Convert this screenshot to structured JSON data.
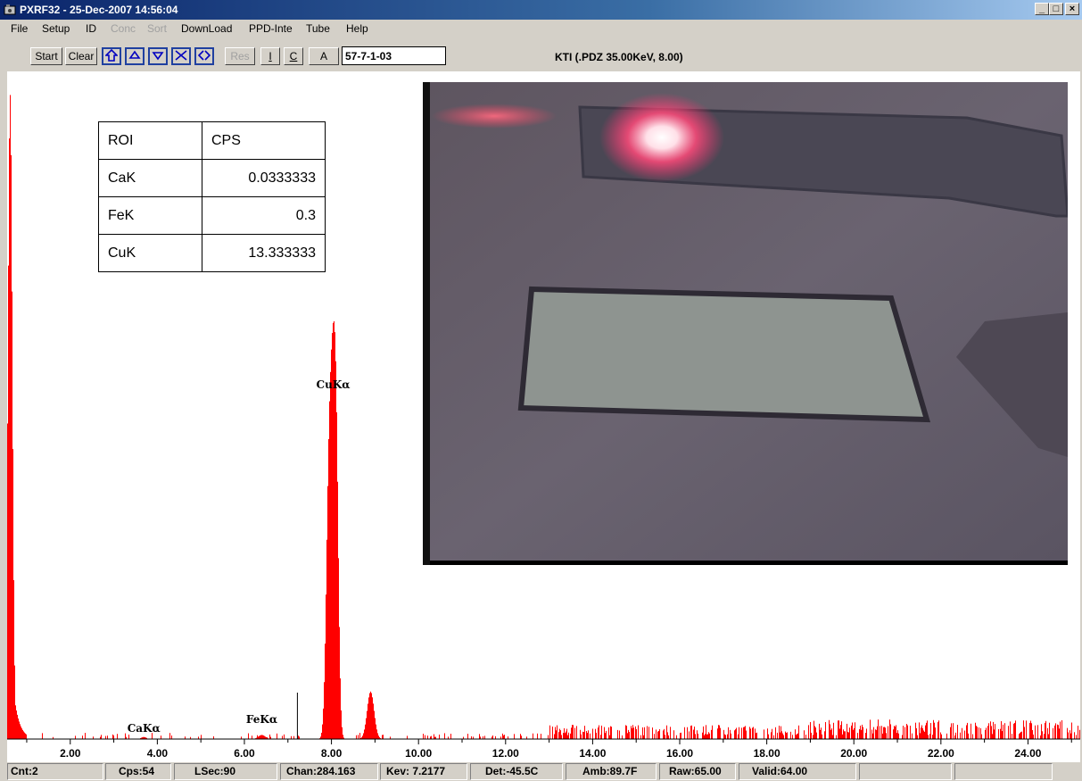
{
  "window": {
    "title": "PXRF32 - 25-Dec-2007 14:56:04",
    "minimize": "_",
    "maximize": "□",
    "close": "×"
  },
  "menu": [
    {
      "label": "File",
      "enabled": true
    },
    {
      "label": "Setup",
      "enabled": true
    },
    {
      "label": "ID",
      "enabled": true
    },
    {
      "label": "Conc",
      "enabled": false
    },
    {
      "label": "Sort",
      "enabled": false
    },
    {
      "label": "DownLoad",
      "enabled": true
    },
    {
      "label": "PPD-Inte",
      "enabled": true
    },
    {
      "label": "Tube",
      "enabled": true
    },
    {
      "label": "Help",
      "enabled": true
    }
  ],
  "toolbar": {
    "start": "Start",
    "clear": "Clear",
    "icon_buttons": [
      "home-up-icon",
      "chevron-up-icon",
      "chevron-down-icon",
      "shrink-icon",
      "expand-icon"
    ],
    "res": "Res",
    "i": "I",
    "c": "C",
    "a": "A",
    "sample_id": "57-7-1-03",
    "tube_info": "KTI  (.PDZ 35.00KeV, 8.00)"
  },
  "roi_table": {
    "headers": [
      "ROI",
      "CPS"
    ],
    "rows": [
      [
        "CaK",
        "0.0333333"
      ],
      [
        "FeK",
        "0.3"
      ],
      [
        "CuK",
        "13.333333"
      ]
    ]
  },
  "chart_data": {
    "type": "bar",
    "x_unit": "keV",
    "xlim": [
      0.55,
      25.2
    ],
    "ticks": [
      "2.00",
      "4.00",
      "6.00",
      "8.00",
      "10.00",
      "12.00",
      "14.00",
      "16.00",
      "18.00",
      "20.00",
      "22.00",
      "24.00"
    ],
    "bar_color": "#ff0000",
    "marker_kev": 7.2177,
    "peak_labels": [
      {
        "label": "CaKα",
        "kev": 3.69
      },
      {
        "label": "FeKα",
        "kev": 6.4
      },
      {
        "label": "CuKα",
        "kev": 8.04
      }
    ],
    "peaks": [
      {
        "kev": 0.62,
        "height": 1.9,
        "width": 0.05
      },
      {
        "kev": 8.04,
        "height": 1.0,
        "width": 0.07
      },
      {
        "kev": 7.93,
        "height": 0.55,
        "width": 0.06
      },
      {
        "kev": 8.12,
        "height": 0.45,
        "width": 0.05
      },
      {
        "kev": 8.9,
        "height": 0.14,
        "width": 0.08
      },
      {
        "kev": 6.4,
        "height": 0.012,
        "width": 0.08
      },
      {
        "kev": 3.69,
        "height": 0.006,
        "width": 0.06
      }
    ]
  },
  "status": {
    "cnt": "Cnt:2",
    "cps": "Cps:54",
    "lsec": "LSec:90",
    "chan": "Chan:284.163",
    "kev": "Kev: 7.2177",
    "det": "Det:-45.5C",
    "amb": "Amb:89.7F",
    "raw": "Raw:65.00",
    "valid": "Valid:64.00"
  },
  "colors": {
    "title_bar": "#0a246a",
    "spectrum": "#ff0000",
    "window_bg": "#d4d0c8"
  }
}
